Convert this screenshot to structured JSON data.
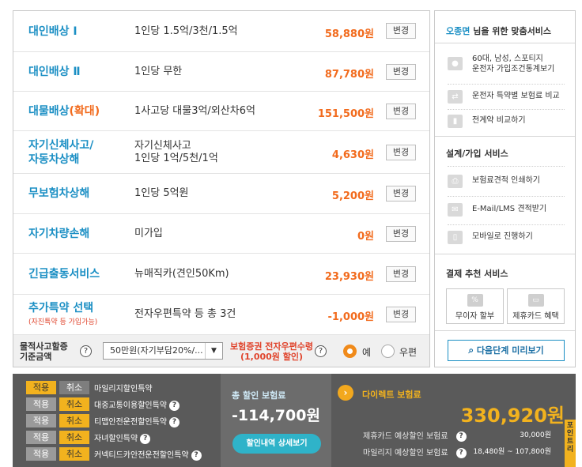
{
  "coverages": [
    {
      "name": "대인배상 Ⅰ",
      "desc": "1인당 1.5억/3천/1.5억",
      "price": "58,880원",
      "btn": "변경"
    },
    {
      "name": "대인배상 Ⅱ",
      "desc": "1인당 무한",
      "price": "87,780원",
      "btn": "변경"
    },
    {
      "name": "대물배상",
      "name_hi": "(확대)",
      "desc": "1사고당 대물3억/외산차6억",
      "price": "151,500원",
      "btn": "변경"
    },
    {
      "name": "자기신체사고/",
      "name2": "자동차상해",
      "desc": "자기신체사고",
      "desc2": "1인당 1억/5천/1억",
      "price": "4,630원",
      "btn": "변경"
    },
    {
      "name": "무보험차상해",
      "desc": "1인당 5억원",
      "price": "5,200원",
      "btn": "변경"
    },
    {
      "name": "자기차량손해",
      "desc": "미가입",
      "price": "0원",
      "btn": "변경"
    },
    {
      "name": "긴급출동서비스",
      "desc": "뉴매직카(견인50Km)",
      "price": "23,930원",
      "btn": "변경"
    },
    {
      "name": "추가특약 선택",
      "sub": "(자진특약 등 가입가능)",
      "desc": "전자우편특약 등 총 3건",
      "price": "-1,000원",
      "btn": "변경"
    }
  ],
  "options": {
    "label1": "물적사고할증",
    "label2": "기준금액",
    "help": "?",
    "select_value": "50만원(자기부담20%/...",
    "select_arrow": "▼",
    "cert1": "보험증권 전자우편수령",
    "cert2": "(1,000원 할인)",
    "radio_yes": "예",
    "radio_post": "우편"
  },
  "services": {
    "name": "오종면",
    "title_suffix": " 님을 위한 맞춤서비스",
    "profile_line1": "60대, 남성, 스포티지",
    "profile_line2": "운전자 가입조건통계보기",
    "compare_special": "운전자 특약별 보험료 비교",
    "compare_all": "전계약 비교하기",
    "design_title": "설계/가입 서비스",
    "print": "보험료견적 인쇄하기",
    "email": "E-Mail/LMS 견적받기",
    "mobile": "모바일로 진행하기",
    "pay_title": "결제 추천 서비스",
    "pay_installment": "무이자 할부",
    "pay_card": "제휴카드 혜택",
    "next": "다음단계 미리보기"
  },
  "discounts": {
    "apply": "적용",
    "cancel": "취소",
    "help": "?",
    "items": [
      {
        "label": "마일리지할인특약",
        "applied": true,
        "help": false
      },
      {
        "label": "대중교통이용할인특약",
        "applied": false,
        "help": true
      },
      {
        "label": "티맵안전운전할인특약",
        "applied": false,
        "help": true
      },
      {
        "label": "자녀할인특약",
        "applied": false,
        "help": true
      },
      {
        "label": "커넥티드카안전운전할인특약",
        "applied": false,
        "help": true
      }
    ]
  },
  "summary": {
    "total_discount_label": "총 할인 보험료",
    "total_discount_value": "-114,700원",
    "detail_button": "할인내역 상세보기",
    "arrow": "›",
    "direct_label": "다이렉트 보험료",
    "direct_value": "330,920원",
    "card_label": "제휴카드 예상할인 보험료",
    "card_value": "30,000원",
    "mileage_label": "마일리지 예상할인 보험료",
    "mileage_value": "18,480원 ~ 107,800원",
    "point_tab": "포인트리"
  },
  "colors": {
    "accent_blue": "#1b8fc4",
    "accent_orange": "#f26b1d",
    "apply_yellow": "#f2b21e",
    "button_teal": "#2fb3c9"
  },
  "icons": {
    "profile": "person-icon",
    "compare": "car-compare-icon",
    "contract": "bookmark-icon",
    "print": "printer-icon",
    "email": "envelope-icon",
    "mobile": "mobile-icon",
    "installment": "percent-card-icon",
    "card": "credit-card-icon",
    "next": "magnifier-icon"
  }
}
